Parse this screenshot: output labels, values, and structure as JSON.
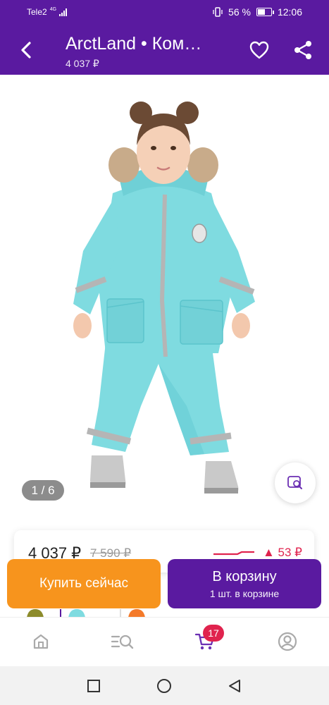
{
  "status_bar": {
    "carrier": "Tele2",
    "network": "4G",
    "battery": "56 %",
    "battery_level": 0.56,
    "time": "12:06"
  },
  "header": {
    "title": "ArctLand  •  Ком…",
    "price": "4 037 ₽",
    "icons": [
      "back-arrow-icon",
      "heart-icon",
      "share-icon"
    ]
  },
  "gallery": {
    "counter": "1 / 6",
    "photo_colors": {
      "suit": "#7fdbe0",
      "suit_shadow": "#5bc4cc",
      "stripe": "#b5b5b5",
      "fur": "#c8ab8a",
      "hair": "#6b4a34"
    },
    "visual_search_icon": "image-search-icon"
  },
  "price_card": {
    "current": "4 037 ₽",
    "old": "7 590 ₽",
    "diff": "▲ 53 ₽"
  },
  "buttons": {
    "buy_now": "Купить сейчас",
    "add_to_cart": "В корзину",
    "cart_info": "1 шт. в корзине"
  },
  "bottom_nav": {
    "items": [
      "home-icon",
      "catalog-search-icon",
      "cart-icon",
      "profile-icon"
    ],
    "cart_badge": "17"
  },
  "colors": {
    "brand": "#5a1aa0",
    "accent": "#f7941d",
    "alert": "#e0234e"
  }
}
